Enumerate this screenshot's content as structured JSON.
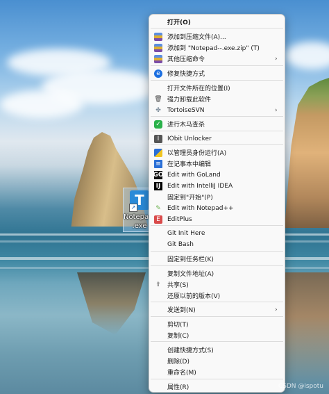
{
  "desktop": {
    "shortcut": {
      "label": "Notepad--\n.exe",
      "glyph": "T"
    }
  },
  "context_menu": {
    "items": [
      {
        "label": "打开(O)",
        "bold": true,
        "icon": "none",
        "submenu": false
      },
      {
        "label": "添加到压缩文件(A)...",
        "icon": "winrar-icon",
        "submenu": false
      },
      {
        "label": "添加到 \"Notepad--.exe.zip\" (T)",
        "icon": "winrar-icon",
        "submenu": false
      },
      {
        "label": "其他压缩命令",
        "icon": "winrar-icon",
        "submenu": true
      },
      {
        "label": "修复快捷方式",
        "icon": "repair-shortcut-icon",
        "submenu": false
      },
      {
        "label": "打开文件所在的位置(I)",
        "icon": "none",
        "submenu": false
      },
      {
        "label": "强力卸载此软件",
        "icon": "trash-icon",
        "submenu": false
      },
      {
        "label": "TortoiseSVN",
        "icon": "tortoise-svn-icon",
        "submenu": true
      },
      {
        "label": "进行木马查杀",
        "icon": "shield-icon",
        "submenu": false
      },
      {
        "label": "IObit Unlocker",
        "icon": "iobit-unlocker-icon",
        "submenu": false
      },
      {
        "label": "以管理员身份运行(A)",
        "icon": "uac-shield-icon",
        "submenu": false
      },
      {
        "label": "在记事本中编辑",
        "icon": "notepad-icon",
        "submenu": false
      },
      {
        "label": "Edit with GoLand",
        "icon": "goland-icon",
        "submenu": false
      },
      {
        "label": "Edit with IntelliJ IDEA",
        "icon": "intellij-icon",
        "submenu": false
      },
      {
        "label": "固定到\"开始\"(P)",
        "icon": "none",
        "submenu": false
      },
      {
        "label": "Edit with Notepad++",
        "icon": "notepad-plus-plus-icon",
        "submenu": false
      },
      {
        "label": "EditPlus",
        "icon": "editplus-icon",
        "submenu": false
      },
      {
        "label": "Git Init Here",
        "icon": "none",
        "submenu": false
      },
      {
        "label": "Git Bash",
        "icon": "none",
        "submenu": false
      },
      {
        "label": "固定到任务栏(K)",
        "icon": "none",
        "submenu": false
      },
      {
        "label": "复制文件地址(A)",
        "icon": "none",
        "submenu": false
      },
      {
        "label": "共享(S)",
        "icon": "share-icon",
        "submenu": false
      },
      {
        "label": "还原以前的版本(V)",
        "icon": "none",
        "submenu": false
      },
      {
        "label": "发送到(N)",
        "icon": "none",
        "submenu": true
      },
      {
        "label": "剪切(T)",
        "icon": "none",
        "submenu": false
      },
      {
        "label": "复制(C)",
        "icon": "none",
        "submenu": false
      },
      {
        "label": "创建快捷方式(S)",
        "icon": "none",
        "submenu": false
      },
      {
        "label": "删除(D)",
        "icon": "none",
        "submenu": false
      },
      {
        "label": "重命名(M)",
        "icon": "none",
        "submenu": false
      },
      {
        "label": "属性(R)",
        "icon": "none",
        "submenu": false
      }
    ]
  },
  "watermark": "CSDN @ispotu"
}
